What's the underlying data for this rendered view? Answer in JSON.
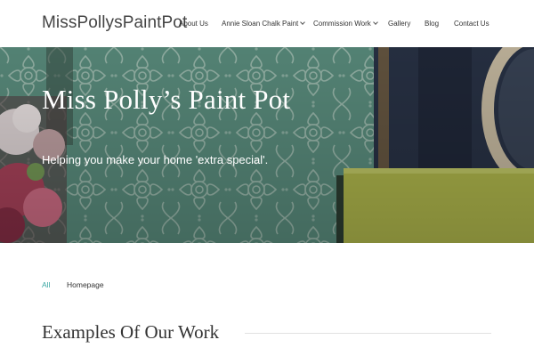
{
  "site": {
    "title": "MissPollysPaintPot"
  },
  "nav": {
    "items": [
      {
        "label": "About Us",
        "has_dropdown": false
      },
      {
        "label": "Annie Sloan Chalk Paint",
        "has_dropdown": true
      },
      {
        "label": "Commission Work",
        "has_dropdown": true
      },
      {
        "label": "Gallery",
        "has_dropdown": false
      },
      {
        "label": "Blog",
        "has_dropdown": false
      },
      {
        "label": "Contact Us",
        "has_dropdown": false
      }
    ]
  },
  "hero": {
    "title": "Miss Polly’s Paint Pot",
    "subtitle": "Helping you make your home 'extra special'."
  },
  "filters": {
    "items": [
      {
        "label": "All",
        "active": true
      },
      {
        "label": "Homepage",
        "active": false
      }
    ]
  },
  "section": {
    "title": "Examples Of Our Work"
  },
  "colors": {
    "accent": "#3aa7a3",
    "hero_green": "#5f8f7e",
    "text": "#333333"
  }
}
